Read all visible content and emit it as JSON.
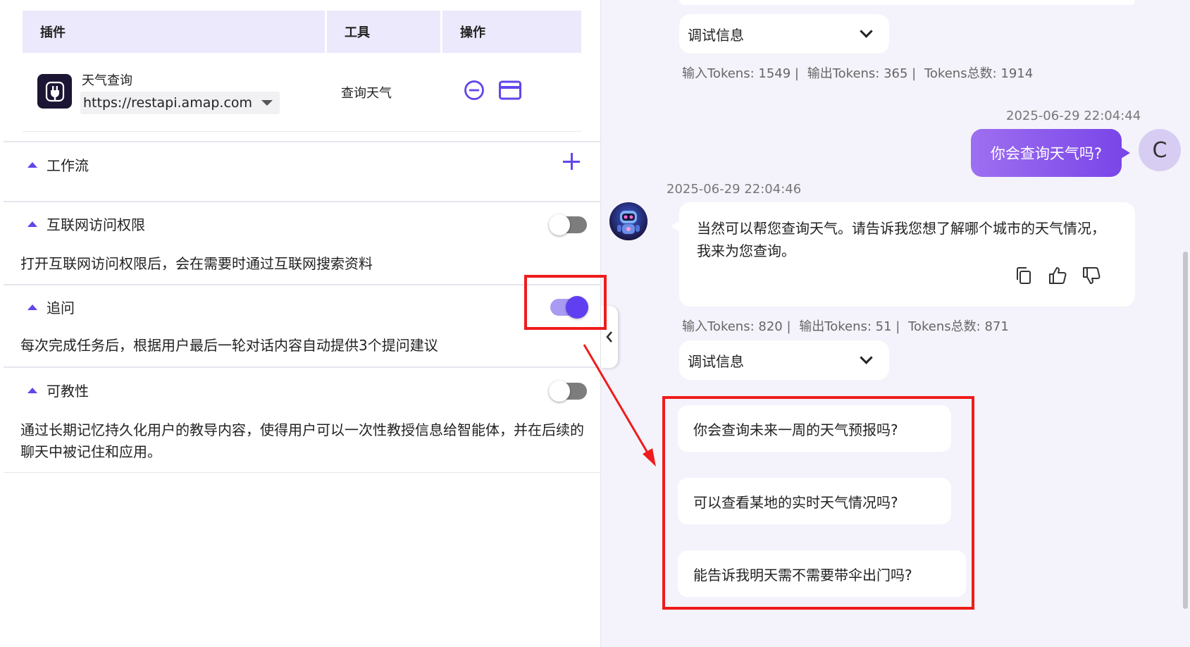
{
  "left": {
    "plugin_table": {
      "headers": [
        "插件",
        "工具",
        "操作"
      ],
      "rows": [
        {
          "name": "天气查询",
          "endpoint": "https://restapi.amap.com",
          "tool": "查询天气"
        }
      ]
    },
    "sections": {
      "workflow": {
        "title": "工作流"
      },
      "internet": {
        "title": "互联网访问权限",
        "desc": "打开互联网访问权限后，会在需要时通过互联网搜索资料",
        "enabled": false
      },
      "followup": {
        "title": "追问",
        "desc": "每次完成任务后，根据用户最后一轮对话内容自动提供3个提问建议",
        "enabled": true
      },
      "teachable": {
        "title": "可教性",
        "desc": "通过长期记忆持久化用户的教导内容，使得用户可以一次性教授信息给智能体，并在后续的聊天中被记住和应用。",
        "enabled": false
      }
    }
  },
  "chat": {
    "debug_label": "调试信息",
    "tokens_1": {
      "input": "输入Tokens: 1549 |",
      "output": "输出Tokens: 365 |",
      "total": "Tokens总数: 1914"
    },
    "user_message": {
      "timestamp": "2025-06-29 22:04:44",
      "text": "你会查询天气吗?",
      "avatar_letter": "C"
    },
    "bot_message": {
      "timestamp": "2025-06-29 22:04:46",
      "text": "当然可以帮您查询天气。请告诉我您想了解哪个城市的天气情况，我来为您查询。"
    },
    "tokens_2": {
      "input": "输入Tokens: 820 |",
      "output": "输出Tokens: 51 |",
      "total": "Tokens总数: 871"
    },
    "suggestions": [
      "你会查询未来一周的天气预报吗?",
      "可以查看某地的实时天气情况吗?",
      "能告诉我明天需不需要带伞出门吗?"
    ]
  },
  "colors": {
    "accent": "#6246ea",
    "annotation": "#ee1c1c",
    "user_bubble": "#7a46e8"
  },
  "icons": [
    "plugin-icon",
    "remove-icon",
    "card-icon",
    "plus-icon",
    "chevron-left-icon",
    "chevron-down-icon",
    "copy-icon",
    "thumbs-up-icon",
    "thumbs-down-icon",
    "robot-icon"
  ]
}
